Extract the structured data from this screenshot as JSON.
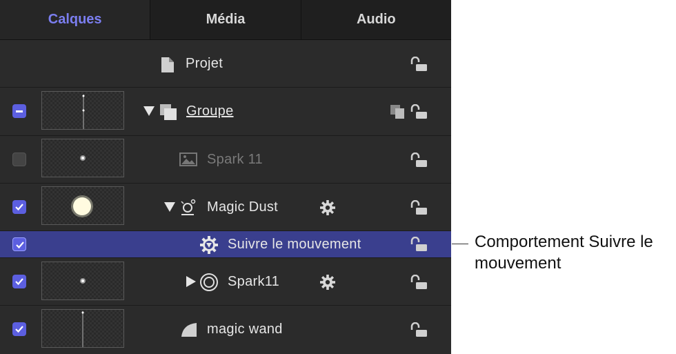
{
  "tabs": [
    {
      "label": "Calques",
      "active": true
    },
    {
      "label": "Média",
      "active": false
    },
    {
      "label": "Audio",
      "active": false
    }
  ],
  "layers": {
    "project": {
      "name": "Projet",
      "icon": "document-icon"
    },
    "group": {
      "name": "Groupe",
      "checkbox": "mixed",
      "icons": [
        "disclosure-open-icon",
        "group-icon",
        "isolate-icon"
      ]
    },
    "spark11_image": {
      "name": "Spark 11",
      "checkbox": "unchecked",
      "icon": "image-icon"
    },
    "magic_dust": {
      "name": "Magic Dust",
      "checkbox": "checked",
      "icons": [
        "disclosure-open-icon",
        "emitter-icon",
        "gear-icon"
      ]
    },
    "follow_motion": {
      "name": "Suivre le mouvement",
      "checkbox": "checked",
      "selected": true,
      "icon": "behavior-icon"
    },
    "spark11_cell": {
      "name": "Spark11",
      "checkbox": "checked",
      "icons": [
        "disclosure-closed-icon",
        "particle-cell-icon",
        "gear-icon"
      ]
    },
    "magic_wand": {
      "name": "magic wand",
      "checkbox": "checked",
      "icon": "shape-icon"
    }
  },
  "callout": {
    "text": "Comportement Suivre le mouvement"
  },
  "colors": {
    "accent": "#5c5fe0",
    "active_tab": "#7b7ef0",
    "selected_row": "#3a3f8e",
    "panel": "#2b2b2b"
  }
}
